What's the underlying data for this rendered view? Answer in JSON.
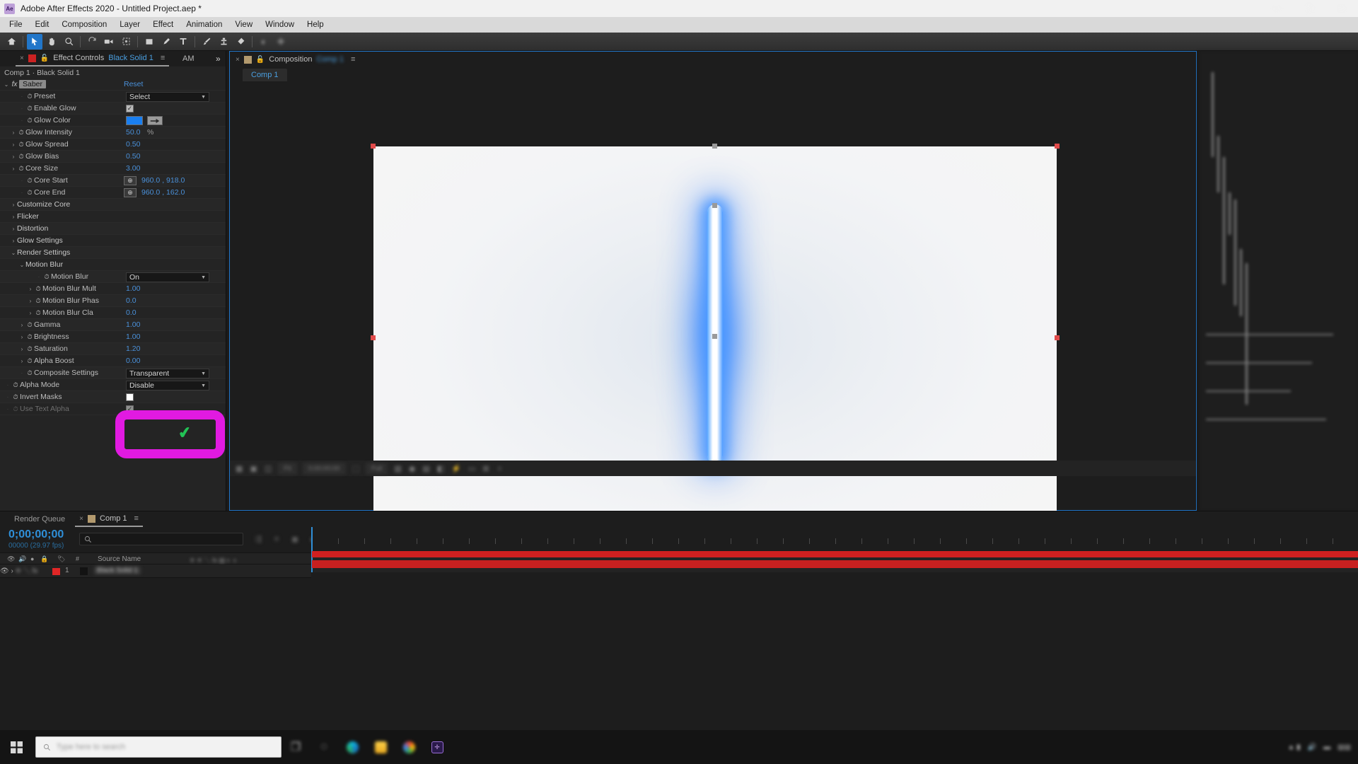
{
  "window": {
    "title": "Adobe After Effects 2020 - Untitled Project.aep *",
    "logo_text": "Ae",
    "minimize": "—",
    "maximize": "❐",
    "close": "✕"
  },
  "menubar": {
    "items": [
      "File",
      "Edit",
      "Composition",
      "Layer",
      "Effect",
      "Animation",
      "View",
      "Window",
      "Help"
    ]
  },
  "toolbar": {
    "icons": [
      "home-icon",
      "selection-tool-icon",
      "hand-tool-icon",
      "zoom-tool-icon",
      "rotation-tool-icon",
      "camera-tool-icon",
      "pan-behind-tool-icon",
      "shape-tool-icon",
      "pen-tool-icon",
      "type-tool-icon",
      "brush-tool-icon",
      "clone-stamp-tool-icon",
      "eraser-tool-icon",
      "roto-brush-tool-icon",
      "puppet-pin-tool-icon"
    ]
  },
  "effect_controls": {
    "tab": {
      "close": "×",
      "panel_name": "Effect Controls",
      "layer_name": "Black Solid 1",
      "menu": "≡",
      "am_label": "AM",
      "chevrons": "»"
    },
    "breadcrumb": "Comp 1 · Black Solid 1",
    "effect_name": "Saber",
    "reset_label": "Reset",
    "fx_label": "fx",
    "rows": [
      {
        "label": "Preset",
        "indent": 2,
        "twirl": "",
        "stopwatch": true,
        "control": "dropdown",
        "value": "Select"
      },
      {
        "label": "Enable Glow",
        "indent": 2,
        "twirl": "",
        "stopwatch": true,
        "control": "checkbox",
        "value": "✓"
      },
      {
        "label": "Glow Color",
        "indent": 2,
        "twirl": "",
        "stopwatch": true,
        "control": "color",
        "value": "#1a7ff0"
      },
      {
        "label": "Glow Intensity",
        "indent": 1,
        "twirl": "›",
        "stopwatch": true,
        "control": "number",
        "value": "50.0",
        "unit": "%"
      },
      {
        "label": "Glow Spread",
        "indent": 1,
        "twirl": "›",
        "stopwatch": true,
        "control": "number",
        "value": "0.50"
      },
      {
        "label": "Glow Bias",
        "indent": 1,
        "twirl": "›",
        "stopwatch": true,
        "control": "number",
        "value": "0.50"
      },
      {
        "label": "Core Size",
        "indent": 1,
        "twirl": "›",
        "stopwatch": true,
        "control": "number",
        "value": "3.00"
      },
      {
        "label": "Core Start",
        "indent": 2,
        "twirl": "",
        "stopwatch": true,
        "control": "position",
        "value": "960.0 , 918.0"
      },
      {
        "label": "Core End",
        "indent": 2,
        "twirl": "",
        "stopwatch": true,
        "control": "position",
        "value": "960.0 , 162.0"
      },
      {
        "label": "Customize Core",
        "indent": 1,
        "twirl": "›",
        "stopwatch": false,
        "control": "group"
      },
      {
        "label": "Flicker",
        "indent": 1,
        "twirl": "›",
        "stopwatch": false,
        "control": "group"
      },
      {
        "label": "Distortion",
        "indent": 1,
        "twirl": "›",
        "stopwatch": false,
        "control": "group"
      },
      {
        "label": "Glow Settings",
        "indent": 1,
        "twirl": "›",
        "stopwatch": false,
        "control": "group"
      },
      {
        "label": "Render Settings",
        "indent": 1,
        "twirl": "⌄",
        "stopwatch": false,
        "control": "group"
      },
      {
        "label": "Motion Blur",
        "indent": 2,
        "twirl": "⌄",
        "stopwatch": false,
        "control": "group"
      },
      {
        "label": "Motion Blur",
        "indent": 4,
        "twirl": "",
        "stopwatch": true,
        "control": "dropdown",
        "value": "On"
      },
      {
        "label": "Motion Blur Mult",
        "indent": 3,
        "twirl": "›",
        "stopwatch": true,
        "control": "number",
        "value": "1.00"
      },
      {
        "label": "Motion Blur Phas",
        "indent": 3,
        "twirl": "›",
        "stopwatch": true,
        "control": "number",
        "value": "0.0"
      },
      {
        "label": "Motion Blur Cla",
        "indent": 3,
        "twirl": "›",
        "stopwatch": true,
        "control": "number",
        "value": "0.0"
      },
      {
        "label": "Gamma",
        "indent": 2,
        "twirl": "›",
        "stopwatch": true,
        "control": "number",
        "value": "1.00"
      },
      {
        "label": "Brightness",
        "indent": 2,
        "twirl": "›",
        "stopwatch": true,
        "control": "number",
        "value": "1.00"
      },
      {
        "label": "Saturation",
        "indent": 2,
        "twirl": "›",
        "stopwatch": true,
        "control": "number",
        "value": "1.20"
      },
      {
        "label": "Alpha Boost",
        "indent": 2,
        "twirl": "›",
        "stopwatch": true,
        "control": "number",
        "value": "0.00"
      },
      {
        "label": "Composite Settings",
        "indent": 2,
        "twirl": "",
        "stopwatch": true,
        "control": "dropdown",
        "value": "Transparent"
      },
      {
        "label": "Alpha Mode",
        "indent": 0,
        "twirl": "",
        "stopwatch": true,
        "control": "dropdown",
        "value": "Disable"
      },
      {
        "label": "Invert Masks",
        "indent": 0,
        "twirl": "",
        "stopwatch": true,
        "control": "checkbox",
        "value": ""
      },
      {
        "label": "Use Text Alpha",
        "indent": 0,
        "twirl": "",
        "stopwatch": true,
        "control": "checkbox",
        "value": "✓",
        "disabled": true
      }
    ],
    "annotation": {
      "highlight_color": "#e11ae1",
      "check_color": "#22c255",
      "check_glyph": "✔"
    }
  },
  "composition": {
    "tab": {
      "close": "×",
      "panel_name": "Composition",
      "comp_name": "Comp 1",
      "menu": "≡"
    },
    "sub_tab": "Comp 1",
    "bottom_bar": {
      "magnification": "Fit",
      "resolution": "Full",
      "current_time": "0;00;00;00",
      "items": [
        "toggle-transparency-grid-icon",
        "toggle-mask-paths-icon",
        "toggle-view-layout-icon",
        "magnification-select",
        "resolution-select",
        "region-of-interest-icon",
        "transparency-grid-icon",
        "active-camera-select",
        "view-count-select",
        "pixel-aspect-icon",
        "fast-previews-icon",
        "timeline-icon",
        "comp-flowchart-icon",
        "reset-exposure-icon"
      ]
    }
  },
  "timeline": {
    "tabs": {
      "render_queue": "Render Queue",
      "comp": "Comp 1",
      "close": "×",
      "menu": "≡"
    },
    "timecode": "0;00;00;00",
    "frames": "00000 (29.97 fps)",
    "search_placeholder": "",
    "columns": {
      "source_name": "Source Name",
      "hash": "#",
      "toggles": [
        "eye-icon",
        "audio-icon",
        "solo-icon",
        "lock-icon",
        "label-icon"
      ]
    },
    "layers": [
      {
        "index": "1",
        "name": "Black Solid 1",
        "label_color": "#e02626"
      }
    ]
  },
  "taskbar": {
    "start_icon": "windows-start-icon",
    "search_placeholder": "Type here to search",
    "apps": [
      "task-view-icon",
      "cortana-icon",
      "edge-browser-icon",
      "file-explorer-icon",
      "chrome-browser-icon",
      "after-effects-icon"
    ],
    "tray": [
      "network-icon",
      "volume-icon",
      "battery-icon",
      "clock"
    ]
  },
  "colors": {
    "accent_blue": "#2176c9",
    "value_blue": "#4a90d9",
    "panel_bg": "#242424",
    "highlight_magenta": "#e11ae1",
    "check_green": "#22c255",
    "layer_red": "#d02020",
    "glow_blue": "#1a7ff0"
  }
}
